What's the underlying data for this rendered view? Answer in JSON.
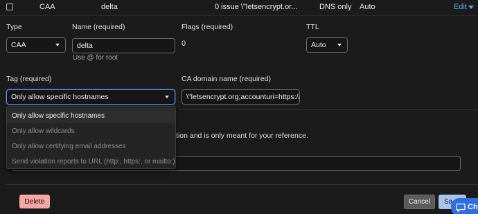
{
  "header_row": {
    "type": "CAA",
    "name": "delta",
    "content": "0 issue \\\"letsencrypt.or...",
    "proxy_status": "DNS only",
    "ttl": "Auto",
    "edit_label": "Edit"
  },
  "form": {
    "type_label": "Type",
    "type_value": "CAA",
    "name_label": "Name (required)",
    "name_value": "delta",
    "name_hint": "Use @ for root",
    "flags_label": "Flags (required)",
    "flags_value": "0",
    "ttl_label": "TTL",
    "ttl_value": "Auto",
    "tag_label": "Tag (required)",
    "tag_value": "Only allow specific hostnames",
    "ca_label": "CA domain name (required)",
    "ca_value": "\\\"letsencrypt.org;accounturi=https://"
  },
  "tag_options": [
    {
      "label": "Only allow specific hostnames",
      "active": true
    },
    {
      "label": "Only allow wildcards",
      "active": false
    },
    {
      "label": "Only allow certifying email addresses",
      "active": false
    },
    {
      "label": "Send violation reports to URL (http:, https:, or mailto:)",
      "active": false
    }
  ],
  "preview": {
    "note_fragment": "olution and is only meant for your reference."
  },
  "footer": {
    "delete_label": "Delete",
    "cancel_label": "Cancel",
    "save_label": "Sa"
  },
  "chat": {
    "label": "Ch",
    "icon": "chat-bubble-icon"
  },
  "colors": {
    "background": "#1b1b1b",
    "accent": "#4f8ff7",
    "link": "#5ea3ff",
    "danger": "#f4a7a3"
  }
}
